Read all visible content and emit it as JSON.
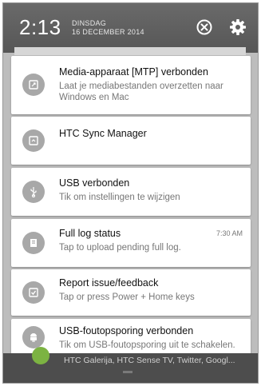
{
  "status_bar": {
    "time": "2:13",
    "weekday": "DINSDAG",
    "date": "16 DECEMBER 2014",
    "clear_icon": "circle-x-icon",
    "settings_icon": "gear-icon"
  },
  "notifications": [
    {
      "icon": "media-device-icon",
      "title": "Media-apparaat [MTP] verbonden",
      "text": "Laat je mediabestanden overzetten naar Windows en Mac",
      "time": ""
    },
    {
      "icon": "sync-manager-icon",
      "title": "HTC Sync Manager",
      "text": "",
      "time": ""
    },
    {
      "icon": "usb-icon",
      "title": "USB verbonden",
      "text": "Tik om instellingen te wijzigen",
      "time": ""
    },
    {
      "icon": "log-icon",
      "title": "Full log status",
      "text": "Tap to upload pending full log.",
      "time": "7:30 AM"
    },
    {
      "icon": "checklist-icon",
      "title": "Report issue/feedback",
      "text": "Tap or press Power + Home keys",
      "time": ""
    },
    {
      "icon": "android-debug-icon",
      "title": "USB-foutopsporing verbonden",
      "text": "Tik om USB-foutopsporing uit te schakelen.",
      "time": ""
    }
  ],
  "bottom": {
    "peek_text": "HTC Galerija, HTC Sense TV, Twitter, Googl..."
  }
}
